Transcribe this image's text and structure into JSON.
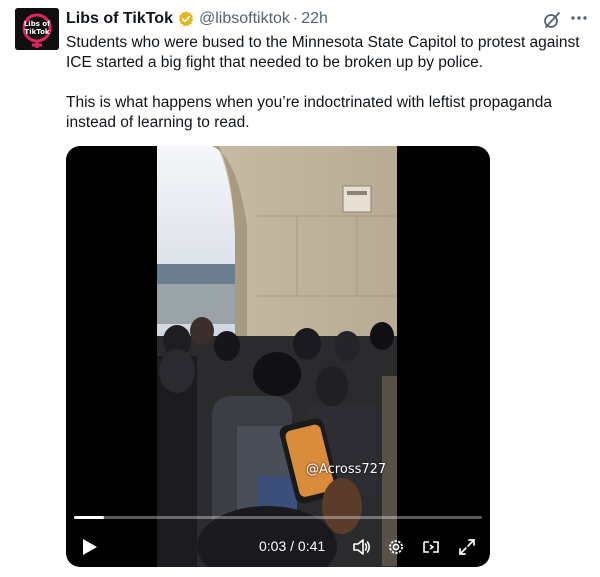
{
  "tweet": {
    "author_name": "Libs of TikTok",
    "handle": "@libsoftiktok",
    "separator": "·",
    "time": "22h",
    "text_p1": "Students who were bused to the Minnesota State Capitol to protest against ICE started a big fight that needed to be broken up by police.",
    "text_p2": "This is what happens when you’re indoctrinated with leftist propaganda instead of learning to read.",
    "avatar_text": "Libs of TikTok"
  },
  "video": {
    "watermark": "@Across727",
    "current_time": "0:03",
    "duration": "0:41",
    "timecode": "0:03 / 0:41",
    "progress_fraction": 0.073
  },
  "icons": {
    "verified": "verified-badge-icon",
    "grok": "grok-icon",
    "more": "more-icon",
    "play": "play-icon",
    "volume": "volume-icon",
    "settings": "gear-icon",
    "captions": "captions-icon",
    "fullscreen": "fullscreen-icon"
  },
  "colors": {
    "verified_gold": "#e2b719",
    "secondary_text": "#536471",
    "primary_text": "#0f1419",
    "video_bg": "#000000"
  }
}
